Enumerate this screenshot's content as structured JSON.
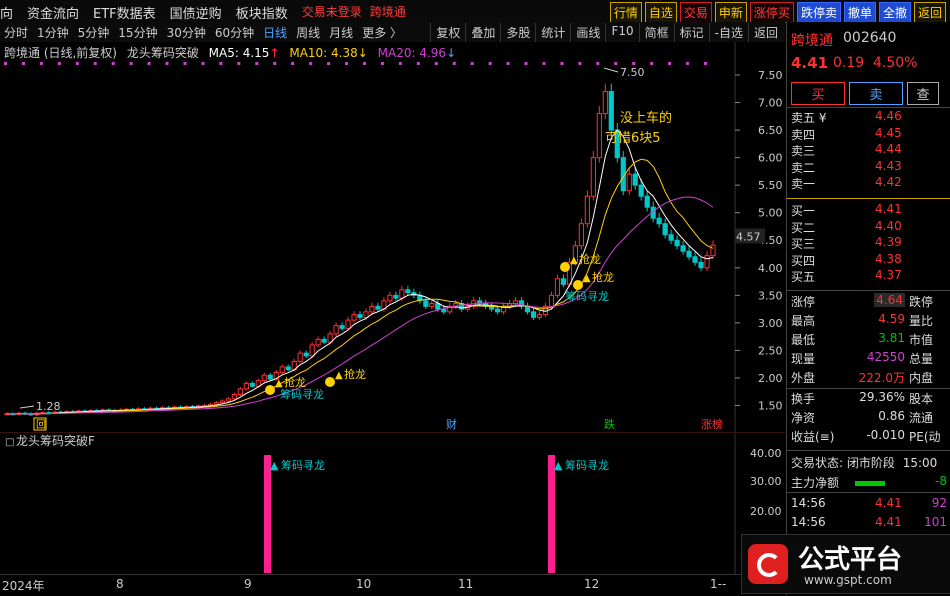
{
  "menu": {
    "items": [
      "向",
      "资金流向",
      "ETF数据表",
      "国债逆购",
      "板块指数"
    ],
    "warn1": "交易未登录",
    "warn2": "跨境通"
  },
  "toolbar": {
    "buttons": [
      "行情",
      "自选",
      "交易",
      "申新",
      "涨停买",
      "跌停卖",
      "撤单",
      "全撤",
      "返回"
    ]
  },
  "periods": [
    "分时",
    "1分钟",
    "5分钟",
    "15分钟",
    "30分钟",
    "60分钟",
    "日线",
    "周线",
    "月线",
    "更多 〉"
  ],
  "period_active": "日线",
  "tools": [
    "复权",
    "叠加",
    "多股",
    "统计",
    "画线",
    "F10",
    "简框",
    "标记",
    "-自选",
    "返回"
  ],
  "legend": {
    "name": "跨境通 (日线,前复权)",
    "indicator": "龙头筹码突破",
    "ma5": "MA5: 4.15",
    "ma10": "MA10: 4.38",
    "ma20": "MA20: 4.96"
  },
  "annotations": {
    "signal": "抢龙",
    "signal2": "筹码寻龙",
    "note1": "没上车的",
    "note2": "可惜6块5",
    "high": "7.50",
    "low": "1.28",
    "cai": "财",
    "die": "跌",
    "zhangbang": "涨榜",
    "hui": "回",
    "price_tag": "4.57"
  },
  "price_axis": [
    "7.50",
    "7.00",
    "6.50",
    "6.00",
    "5.50",
    "5.00",
    "4.50",
    "4.00",
    "3.50",
    "3.00",
    "2.50",
    "2.00",
    "1.50"
  ],
  "sub": {
    "title": "龙头筹码突破F",
    "signal": "筹码寻龙",
    "axis": [
      "40.00",
      "30.00",
      "20.00"
    ]
  },
  "time_axis": [
    "2024年",
    "8",
    "9",
    "10",
    "11",
    "12",
    "1--"
  ],
  "quote": {
    "name": "跨境通",
    "code": "002640",
    "price": "4.41",
    "change": "0.19",
    "pct": "4.50%",
    "buy": "买",
    "sell": "卖",
    "query": "查"
  },
  "orderbook": [
    {
      "label": "卖五 ¥",
      "price": "4.46"
    },
    {
      "label": "卖四",
      "price": "4.45"
    },
    {
      "label": "卖三",
      "price": "4.44"
    },
    {
      "label": "卖二",
      "price": "4.43"
    },
    {
      "label": "卖一",
      "price": "4.42"
    },
    {
      "label": "买一",
      "price": "4.41"
    },
    {
      "label": "买二",
      "price": "4.40"
    },
    {
      "label": "买三",
      "price": "4.39"
    },
    {
      "label": "买四",
      "price": "4.38"
    },
    {
      "label": "买五",
      "price": "4.37"
    }
  ],
  "stats": [
    {
      "l1": "涨停",
      "v1": "4.64",
      "l2": "跌停"
    },
    {
      "l1": "最高",
      "v1": "4.59",
      "l2": "量比"
    },
    {
      "l1": "最低",
      "v1": "3.81",
      "l2": "市值"
    },
    {
      "l1": "现量",
      "v1": "42550",
      "l2": "总量"
    },
    {
      "l1": "外盘",
      "v1": "222.0万",
      "l2": "内盘"
    },
    {
      "l1": "换手",
      "v1": "29.36%",
      "l2": "股本"
    },
    {
      "l1": "净资",
      "v1": "0.86",
      "l2": "流通"
    },
    {
      "l1": "收益(≡)",
      "v1": "-0.010",
      "l2": "PE(动"
    }
  ],
  "status": {
    "label": "交易状态:",
    "value": "闭市阶段",
    "time": "15:00"
  },
  "flow": {
    "label": "主力净额",
    "value": "-8"
  },
  "ticks": [
    {
      "time": "14:56",
      "price": "4.41",
      "vol": "92"
    },
    {
      "time": "14:56",
      "price": "4.41",
      "vol": "101"
    }
  ],
  "brand": {
    "name": "公式平台",
    "url": "www.gspt.com"
  },
  "colors": {
    "up": "#ff3030",
    "down": "#00c8c8",
    "ma5": "#ffffff",
    "ma10": "#ffd000",
    "ma20": "#d040d0",
    "signal": "#ff1f8f"
  },
  "chart_data": {
    "type": "candlestick",
    "ylim": [
      1.2,
      7.7
    ],
    "close": [
      1.35,
      1.34,
      1.36,
      1.35,
      1.33,
      1.36,
      1.37,
      1.36,
      1.38,
      1.37,
      1.39,
      1.38,
      1.4,
      1.39,
      1.41,
      1.4,
      1.42,
      1.41,
      1.4,
      1.42,
      1.43,
      1.41,
      1.44,
      1.43,
      1.45,
      1.44,
      1.46,
      1.45,
      1.47,
      1.46,
      1.48,
      1.47,
      1.49,
      1.5,
      1.52,
      1.55,
      1.58,
      1.62,
      1.7,
      1.8,
      1.9,
      1.85,
      1.95,
      2.05,
      1.98,
      2.1,
      2.2,
      2.15,
      2.3,
      2.45,
      2.4,
      2.6,
      2.7,
      2.65,
      2.8,
      2.95,
      2.9,
      3.05,
      3.15,
      3.1,
      3.2,
      3.3,
      3.25,
      3.4,
      3.5,
      3.45,
      3.6,
      3.55,
      3.5,
      3.4,
      3.3,
      3.35,
      3.25,
      3.2,
      3.3,
      3.35,
      3.25,
      3.3,
      3.4,
      3.35,
      3.3,
      3.25,
      3.2,
      3.3,
      3.35,
      3.4,
      3.3,
      3.2,
      3.1,
      3.15,
      3.3,
      3.5,
      3.8,
      3.7,
      4.1,
      4.4,
      4.8,
      5.3,
      6.0,
      6.8,
      7.2,
      6.5,
      6.0,
      5.4,
      5.7,
      5.5,
      5.3,
      5.1,
      4.9,
      4.8,
      4.6,
      4.5,
      4.4,
      4.3,
      4.2,
      4.1,
      4.0,
      4.22,
      4.41
    ]
  }
}
